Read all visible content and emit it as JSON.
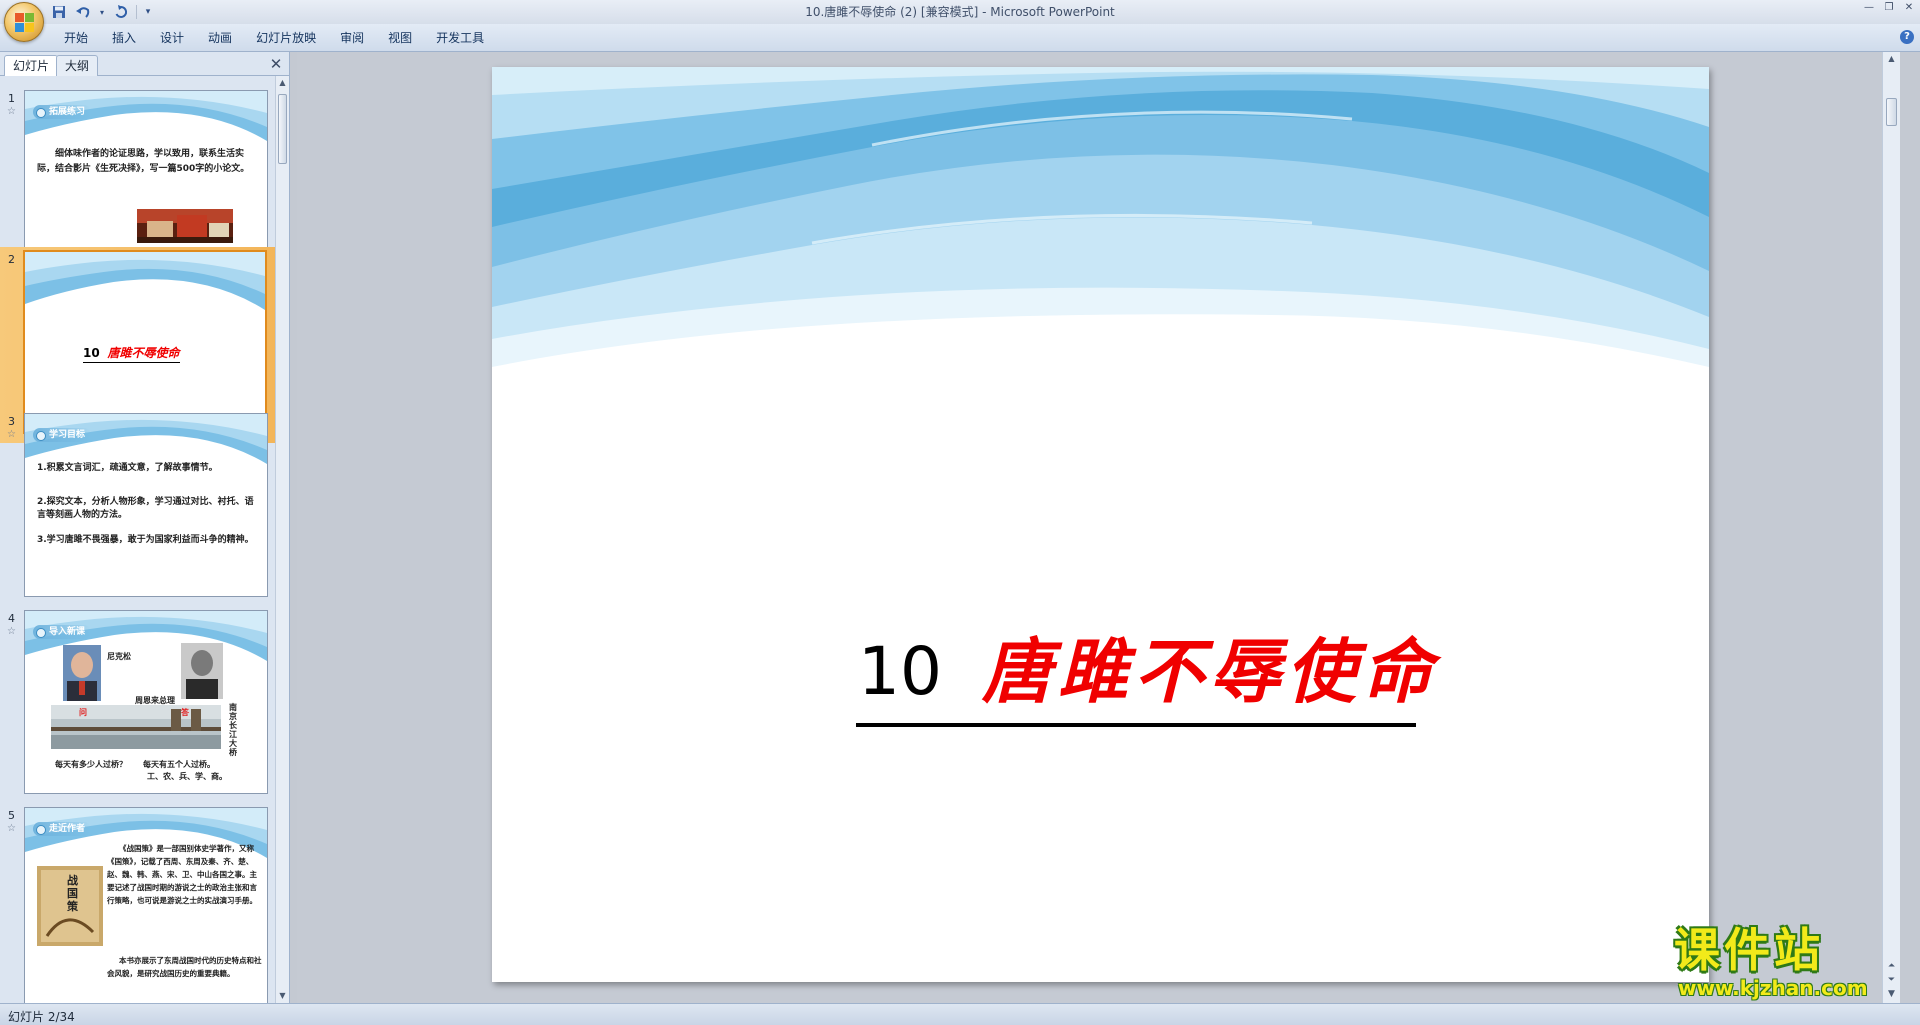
{
  "window": {
    "title": "10.唐雎不辱使命 (2) [兼容模式] - Microsoft PowerPoint"
  },
  "quick_access": {
    "icons": [
      "save-icon",
      "undo-icon",
      "redo-icon",
      "customize-icon"
    ]
  },
  "ribbon": {
    "tabs": [
      "开始",
      "插入",
      "设计",
      "动画",
      "幻灯片放映",
      "审阅",
      "视图",
      "开发工具"
    ]
  },
  "left_panel": {
    "tab_slides": "幻灯片",
    "tab_outline": "大纲",
    "thumbnails": [
      {
        "number": "1",
        "heading": "拓展练习",
        "text": "细体味作者的论证思路，学以致用，联系生活实际，结合影片《生死决择》，写一篇500字的小论文。"
      },
      {
        "number": "2",
        "title_num": "10",
        "title_text": "唐雎不辱使命"
      },
      {
        "number": "3",
        "heading": "学习目标",
        "items": [
          "1.积累文言词汇，疏通文意，了解故事情节。",
          "2.探究文本，分析人物形象，学习通过对比、衬托、语言等刻画人物的方法。",
          "3.学习唐雎不畏强暴，敢于为国家利益而斗争的精神。"
        ]
      },
      {
        "number": "4",
        "heading": "导入新课",
        "label_a": "尼克松",
        "label_b": "周恩来总理",
        "label_c": "南京长江大桥",
        "bridge_left": "问",
        "bridge_right": "答",
        "caption_a": "每天有多少人过桥？",
        "caption_b": "每天有五个人过桥。",
        "caption_c": "工、农、兵、学、商。"
      },
      {
        "number": "5",
        "heading": "走近作者",
        "book_title": "战国策",
        "text": "《战国策》是一部国别体史学著作，又称《国策》，记载了西周、东周及秦、齐、楚、赵、魏、韩、燕、宋、卫、中山各国之事。主要记述了战国时期的游说之士的政治主张和言行策略，也可说是游说之士的实战演习手册。",
        "text2": "本书亦展示了东周战国时代的历史特点和社会风貌，是研究战国历史的重要典籍。"
      }
    ]
  },
  "slide": {
    "title_num": "10",
    "title_text": "唐雎不辱使命"
  },
  "status": {
    "slide_indicator": "幻灯片 2/34"
  },
  "watermark": {
    "main": "课件站",
    "sub": "www.kjzhan.com"
  },
  "colors": {
    "title_red": "#f00000",
    "wave_blue": "#5aaedc",
    "selection_orange": "#f3b559"
  }
}
